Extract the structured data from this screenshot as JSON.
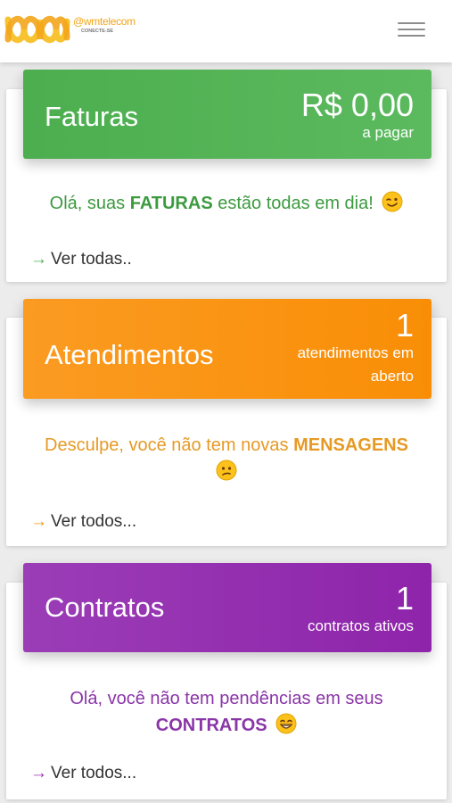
{
  "brand": {
    "name": "@wmtelecom",
    "tagline": "CONECTE-SE",
    "colors": {
      "primary": "#f3a51b",
      "secondary": "#f7c331"
    }
  },
  "faturas": {
    "title": "Faturas",
    "amount": "R$ 0,00",
    "amount_label": "a pagar",
    "message_prefix": "Olá, suas ",
    "message_bold": "FATURAS",
    "message_suffix": " estão todas em dia!",
    "emoji": "winking-face",
    "link": "Ver todas..",
    "color": "#4cae4f"
  },
  "atendimentos": {
    "title": "Atendimentos",
    "count": "1",
    "count_label_line1": "atendimentos em",
    "count_label_line2": "aberto",
    "message_prefix": "Desculpe, você não tem novas ",
    "message_bold": "MENSAGENS",
    "emoji": "confused-face",
    "link": "Ver todos...",
    "color": "#f7941d"
  },
  "contratos": {
    "title": "Contratos",
    "count": "1",
    "count_label": "contratos ativos",
    "message_prefix": "Olá, você não tem pendências em seus",
    "message_bold": "CONTRATOS",
    "emoji": "grinning-face",
    "link": "Ver todos...",
    "color": "#9c27b0"
  }
}
